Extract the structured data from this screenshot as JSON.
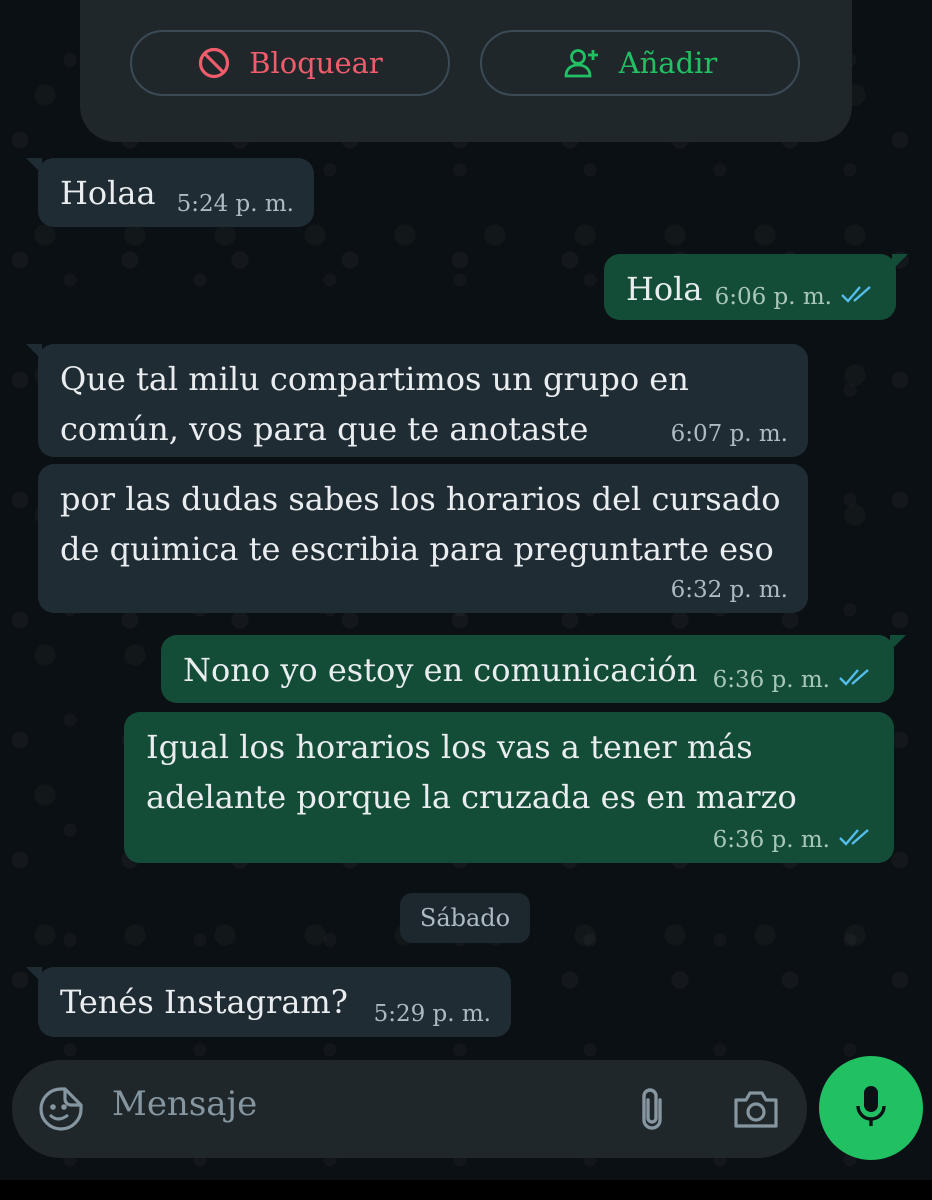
{
  "contact_actions": {
    "block_label": "Bloquear",
    "add_label": "Añadir"
  },
  "messages": [
    {
      "direction": "in",
      "text": "Holaa",
      "time": "5:24 p. m."
    },
    {
      "direction": "out",
      "text": "Hola",
      "time": "6:06 p. m.",
      "status": "read"
    },
    {
      "direction": "in",
      "text": "Que tal milu compartimos un grupo en común, vos para que te anotaste",
      "time": "6:07 p. m."
    },
    {
      "direction": "in",
      "text": "por las dudas sabes los horarios del cursado de quimica te escribia para preguntarte eso",
      "time": "6:32 p. m."
    },
    {
      "direction": "out",
      "text": "Nono yo estoy en comunicación",
      "time": "6:36 p. m.",
      "status": "read"
    },
    {
      "direction": "out",
      "text": "Igual los horarios los vas a tener más adelante porque la cruzada es en marzo",
      "time": "6:36 p. m.",
      "status": "read"
    },
    {
      "direction": "in",
      "text": "Tenés Instagram?",
      "time": "5:29 p. m."
    }
  ],
  "day_separator": "Sábado",
  "composer": {
    "placeholder": "Mensaje"
  },
  "colors": {
    "incoming_bubble": "#202c33",
    "outgoing_bubble": "#144d37",
    "accent_green": "#21c063",
    "block_red": "#f15c6d",
    "read_ticks": "#53bdeb"
  },
  "icons": [
    "block-icon",
    "add-contact-icon",
    "double-check-icon",
    "sticker-emoji-icon",
    "attach-icon",
    "camera-icon",
    "mic-icon"
  ]
}
